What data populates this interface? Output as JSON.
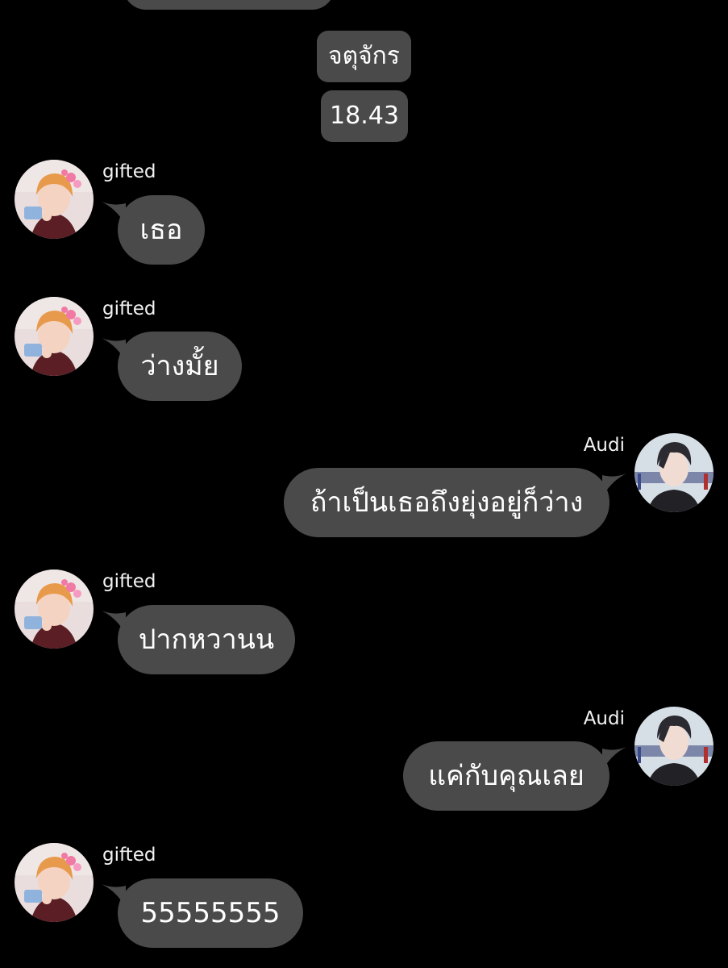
{
  "chat": {
    "date_label": "จตุจักร",
    "time_label": "18.43",
    "messages": [
      {
        "sender": "gifted",
        "text": "เธอ",
        "side": "left",
        "avatar": "gifted-avatar"
      },
      {
        "sender": "gifted",
        "text": "ว่างมั้ย",
        "side": "left",
        "avatar": "gifted-avatar"
      },
      {
        "sender": "Audi",
        "text": "ถ้าเป็นเธอถึงยุ่งอยู่ก็ว่าง",
        "side": "right",
        "avatar": "audi-avatar"
      },
      {
        "sender": "gifted",
        "text": "ปากหวานน",
        "side": "left",
        "avatar": "gifted-avatar"
      },
      {
        "sender": "Audi",
        "text": "แค่กับคุณเลย",
        "side": "right",
        "avatar": "audi-avatar"
      },
      {
        "sender": "gifted",
        "text": "55555555",
        "side": "left",
        "avatar": "gifted-avatar"
      }
    ]
  },
  "colors": {
    "background": "#000000",
    "bubble": "#4a4a4a",
    "text": "#ffffff"
  }
}
